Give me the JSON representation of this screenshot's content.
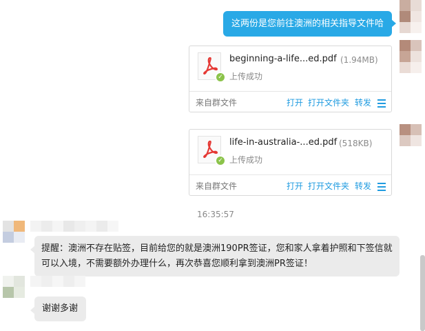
{
  "messages": {
    "outgoing_text": "这两份是您前往澳洲的相关指导文件哈",
    "files": [
      {
        "name": "beginning-a-life...ed.pdf",
        "size": "(1.94MB)",
        "status": "上传成功",
        "source": "来自群文件",
        "actions": {
          "open": "打开",
          "open_folder": "打开文件夹",
          "forward": "转发"
        }
      },
      {
        "name": "life-in-australia-...ed.pdf",
        "size": "(518KB)",
        "status": "上传成功",
        "source": "来自群文件",
        "actions": {
          "open": "打开",
          "open_folder": "打开文件夹",
          "forward": "转发"
        }
      }
    ],
    "timestamp": "16:35:57",
    "incoming_reminder_line1": "提醒：澳洲不存在贴签，目前给您的就是澳洲190PR签证，您和家人拿着护照和下签信就",
    "incoming_reminder_line2": "可以入境，不需要额外办理什么，再次恭喜您顺利拿到澳洲PR签证！",
    "incoming_thanks": "谢谢多谢"
  },
  "icons": {
    "file_type": "pdf-icon",
    "upload_ok": "check-circle-icon",
    "more": "menu-icon"
  },
  "colors": {
    "accent_blue": "#29a9e6",
    "link_blue": "#1f9be0",
    "success_green": "#8bc34a",
    "bubble_gray": "#ebebeb",
    "pdf_red": "#e53935"
  }
}
